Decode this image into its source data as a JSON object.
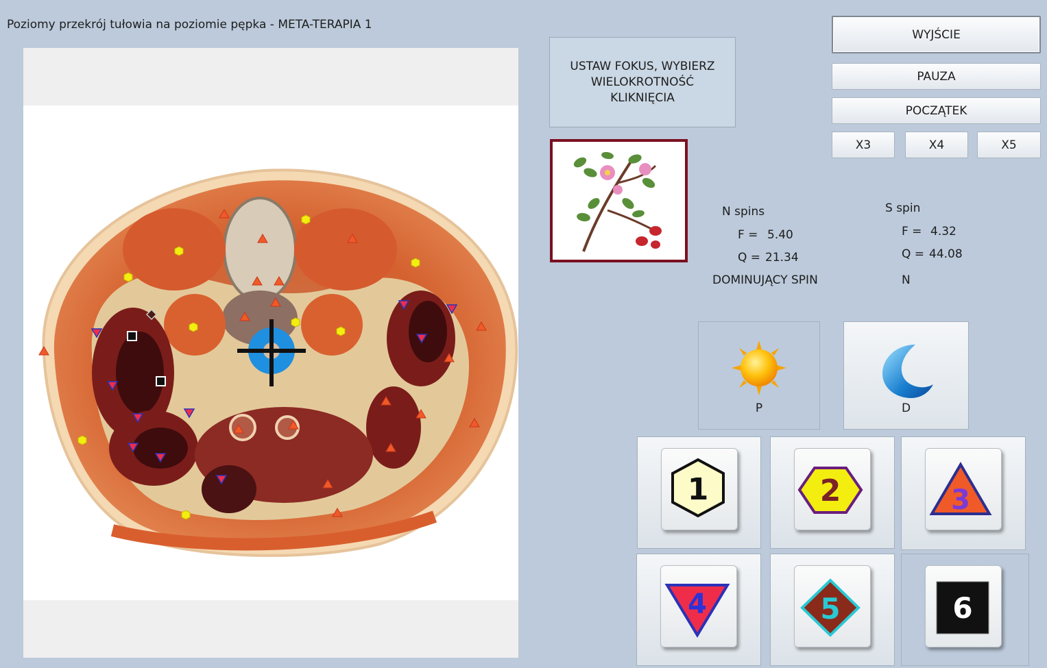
{
  "window": {
    "title": "Poziomy przekrój tułowia na poziomie pępka - META-TERAPIA 1"
  },
  "controls": {
    "exit_label": "WYJŚCIE",
    "pause_label": "PAUZA",
    "start_label": "POCZĄTEK",
    "multipliers": [
      "X3",
      "X4",
      "X5"
    ]
  },
  "instruction": "USTAW FOKUS, WYBIERZ WIELOKROTNOŚĆ KLIKNIĘCIA",
  "spins": {
    "n": {
      "heading": "N spins",
      "f_label": "F =",
      "f_value": "5.40",
      "q_label": "Q =",
      "q_value": "21.34"
    },
    "s": {
      "heading": "S spin",
      "f_label": "F =",
      "f_value": "4.32",
      "q_label": "Q =",
      "q_value": "44.08"
    },
    "dominant_label": "DOMINUJĄCY SPIN",
    "dominant_value": "N"
  },
  "modes": [
    {
      "label": "P",
      "icon": "sun-icon",
      "selected": true
    },
    {
      "label": "D",
      "icon": "moon-icon",
      "selected": false
    }
  ],
  "markers": [
    {
      "label": "1",
      "icon": "hexagon-light-yellow-icon",
      "fill": "#fdfcc8"
    },
    {
      "label": "2",
      "icon": "hexagon-yellow-icon",
      "fill": "#f3ee10"
    },
    {
      "label": "3",
      "icon": "triangle-orange-icon",
      "fill": "#f05a28"
    },
    {
      "label": "4",
      "icon": "triangle-down-red-icon",
      "fill": "#ef2d4a"
    },
    {
      "label": "5",
      "icon": "diamond-brown-icon",
      "fill": "#8a2a1a"
    },
    {
      "label": "6",
      "icon": "square-black-icon",
      "fill": "#111111",
      "selected": true
    }
  ],
  "colors": {
    "background": "#bccadb",
    "frame": "#7a1020",
    "target": "#1f8fe0"
  }
}
